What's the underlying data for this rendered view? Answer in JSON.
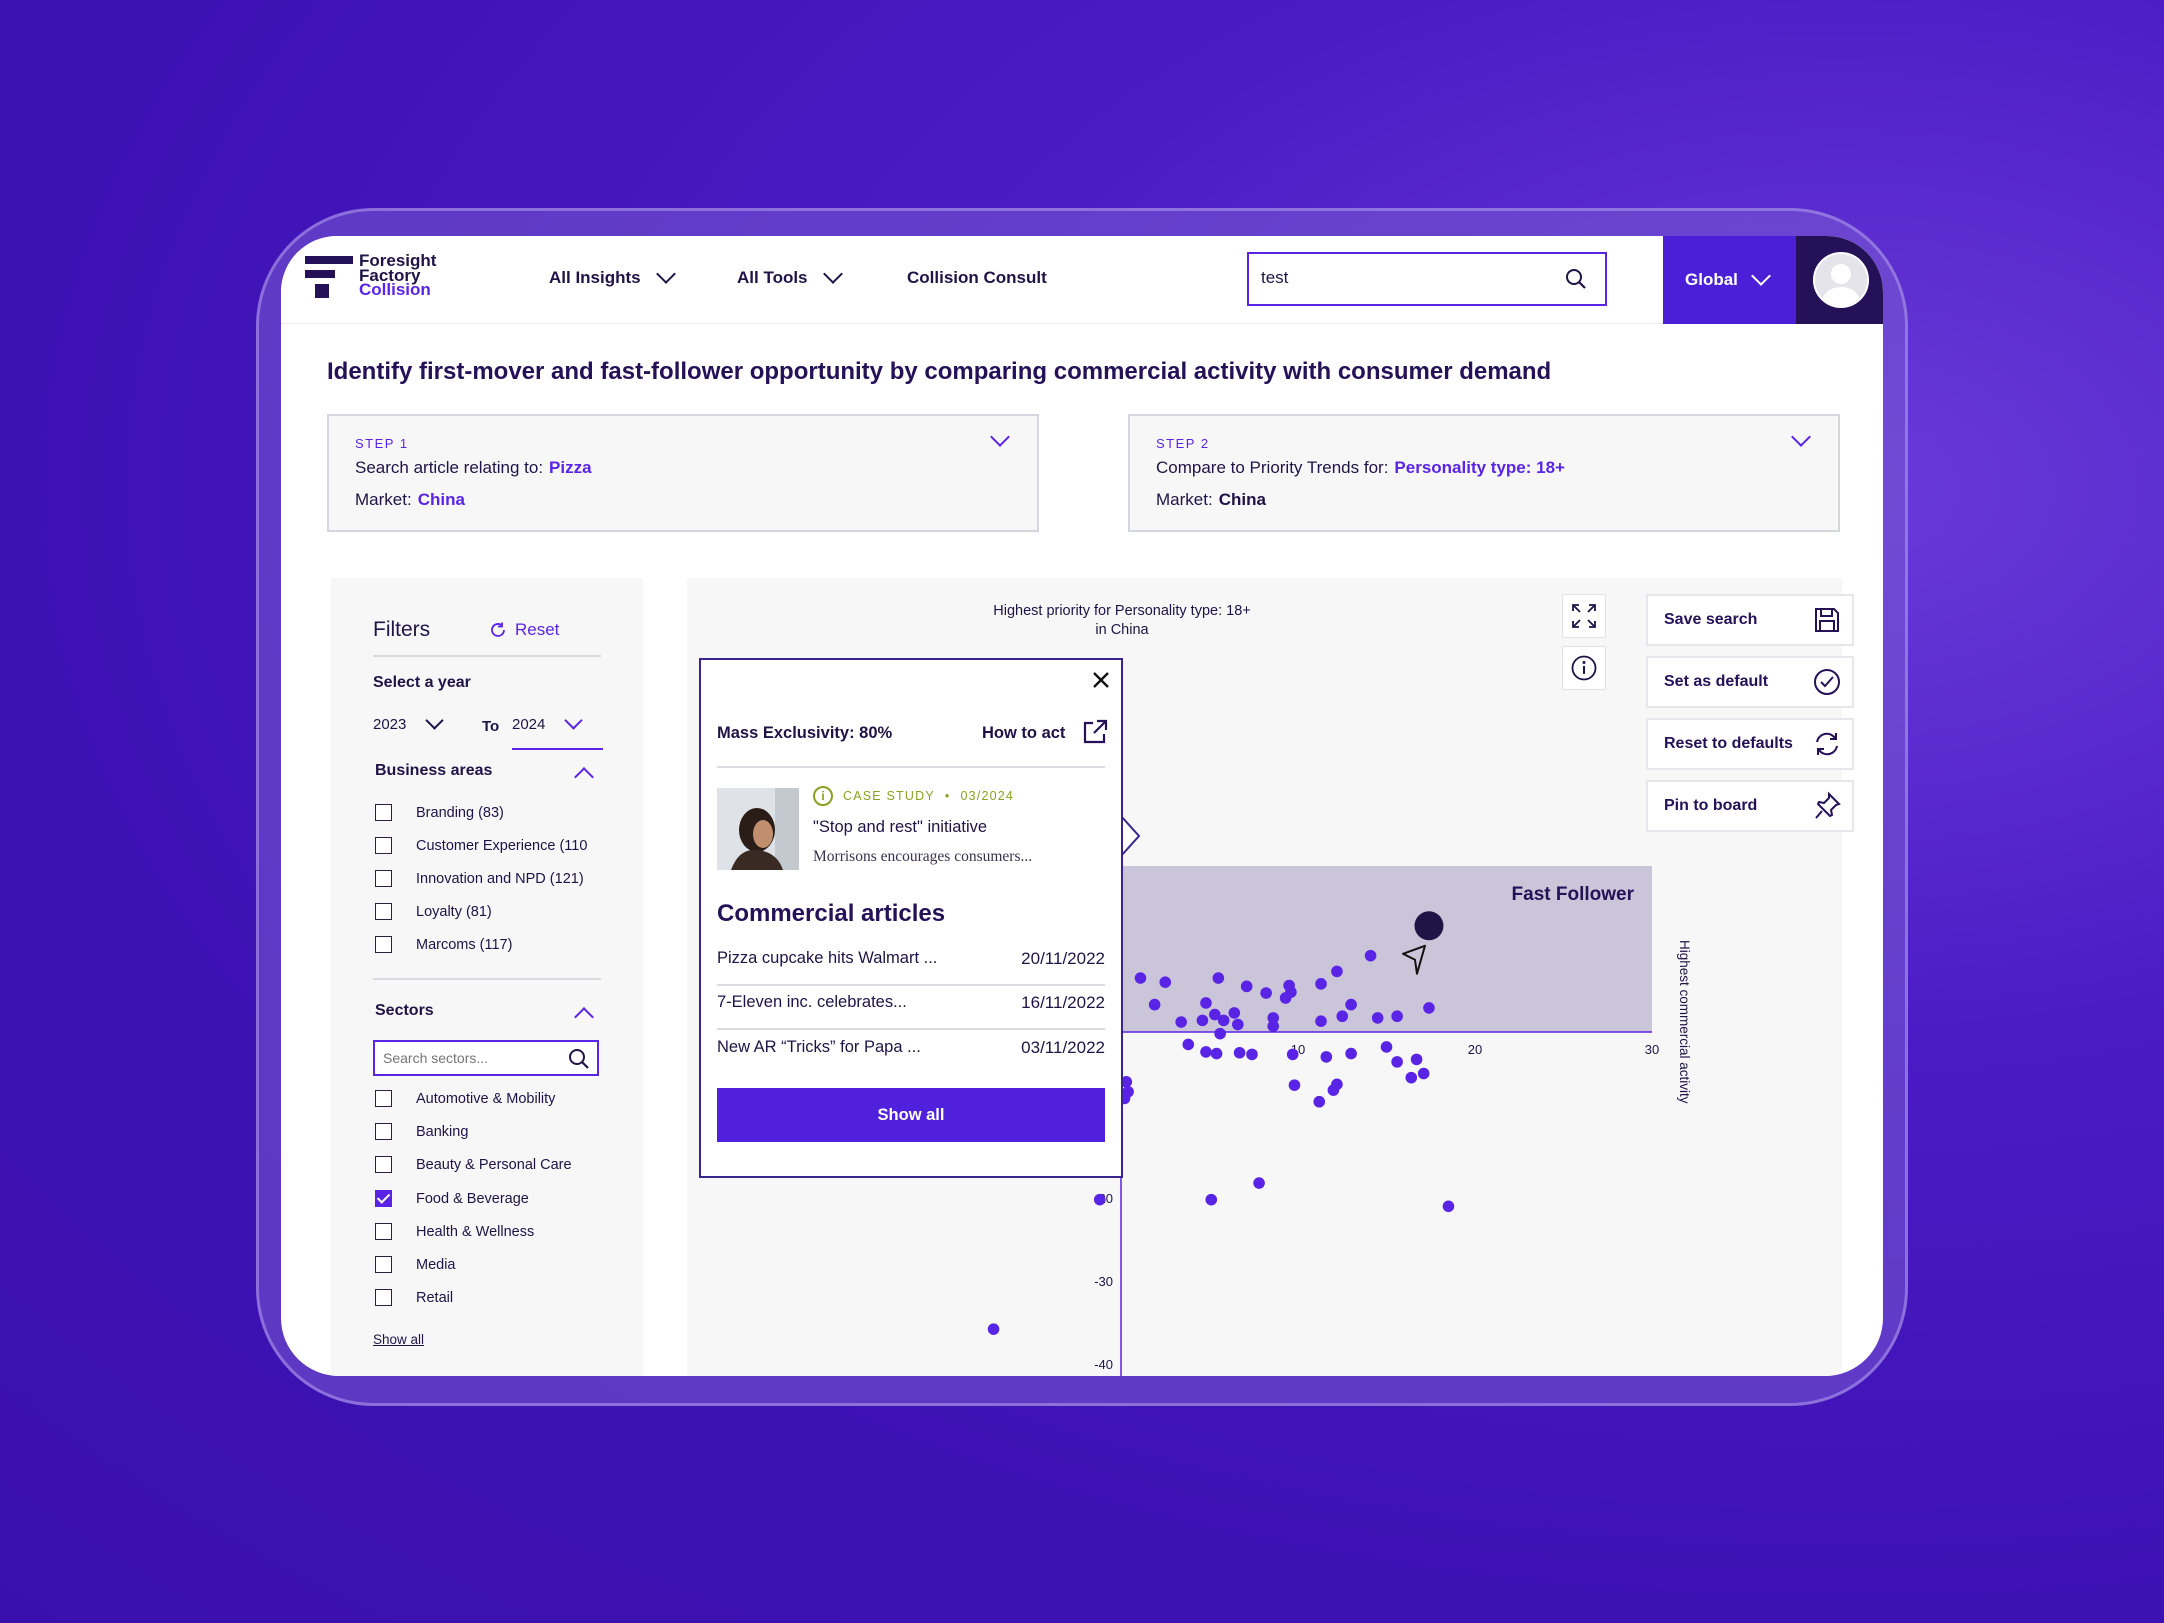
{
  "brand": {
    "line1": "Foresight",
    "line2": "Factory",
    "line3": "Collision"
  },
  "nav": {
    "insights": "All Insights",
    "tools": "All Tools",
    "consult": "Collision Consult"
  },
  "search": {
    "value": "test"
  },
  "region": {
    "label": "Global"
  },
  "headline": "Identify first-mover and fast-follower opportunity by comparing commercial activity with consumer demand",
  "step1": {
    "label": "STEP 1",
    "search_prefix": "Search article relating to:",
    "search_value": "Pizza",
    "market_prefix": "Market:",
    "market_value": "China"
  },
  "step2": {
    "label": "STEP 2",
    "compare_prefix": "Compare to Priority Trends for:",
    "compare_value": "Personality type: 18+",
    "market_prefix": "Market:",
    "market_value": "China"
  },
  "filters": {
    "title": "Filters",
    "reset": "Reset",
    "year_label": "Select a year",
    "year_from": "2023",
    "year_to_label": "To",
    "year_to": "2024",
    "business_title": "Business areas",
    "business": [
      {
        "label": "Branding (83)",
        "checked": false
      },
      {
        "label": "Customer Experience (110",
        "checked": false
      },
      {
        "label": "Innovation and NPD (121)",
        "checked": false
      },
      {
        "label": "Loyalty (81)",
        "checked": false
      },
      {
        "label": "Marcoms (117)",
        "checked": false
      }
    ],
    "sectors_title": "Sectors",
    "sector_placeholder": "Search sectors...",
    "sectors": [
      {
        "label": "Automotive & Mobility",
        "checked": false
      },
      {
        "label": "Banking",
        "checked": false
      },
      {
        "label": "Beauty & Personal Care",
        "checked": false
      },
      {
        "label": "Food & Beverage",
        "checked": true
      },
      {
        "label": "Health & Wellness",
        "checked": false
      },
      {
        "label": "Media",
        "checked": false
      },
      {
        "label": "Retail",
        "checked": false
      }
    ],
    "show_all": "Show all"
  },
  "actions": {
    "save": "Save search",
    "default": "Set as default",
    "reset": "Reset to defaults",
    "pin": "Pin to board"
  },
  "chart_data": {
    "type": "scatter",
    "title": "Highest priority for Personality type: 18+",
    "subtitle": "in China",
    "ylabel": "Highest commercial activity",
    "quadrant_label": "Fast Follower",
    "x_ticks": [
      "10",
      "20",
      "30"
    ],
    "y_ticks": [
      "-20",
      "-30",
      "-40"
    ],
    "xlim": [
      0,
      30
    ],
    "ylim": [
      -40,
      20
    ],
    "highlight": {
      "x": 17.4,
      "y": 12.8
    },
    "points": [
      [
        1.1,
        6.5
      ],
      [
        2.5,
        6.0
      ],
      [
        1.9,
        3.3
      ],
      [
        5.5,
        6.5
      ],
      [
        7.1,
        5.5
      ],
      [
        8.2,
        4.7
      ],
      [
        9.5,
        5.6
      ],
      [
        9.6,
        4.8
      ],
      [
        9.3,
        4.1
      ],
      [
        11.3,
        5.8
      ],
      [
        12.2,
        7.3
      ],
      [
        14.1,
        9.2
      ],
      [
        13.0,
        3.3
      ],
      [
        12.5,
        1.9
      ],
      [
        14.5,
        1.7
      ],
      [
        15.6,
        1.9
      ],
      [
        17.4,
        2.9
      ],
      [
        6.4,
        2.3
      ],
      [
        4.8,
        3.5
      ],
      [
        5.8,
        1.4
      ],
      [
        4.6,
        1.4
      ],
      [
        5.3,
        2.1
      ],
      [
        8.6,
        1.7
      ],
      [
        3.4,
        1.2
      ],
      [
        5.6,
        -0.2
      ],
      [
        8.6,
        0.7
      ],
      [
        11.3,
        1.3
      ],
      [
        6.6,
        0.9
      ],
      [
        6.7,
        -2.5
      ],
      [
        4.8,
        -2.4
      ],
      [
        3.8,
        -1.5
      ],
      [
        5.4,
        -2.6
      ],
      [
        7.4,
        -2.7
      ],
      [
        9.7,
        -2.7
      ],
      [
        11.6,
        -3.0
      ],
      [
        13.0,
        -2.6
      ],
      [
        15.0,
        -1.8
      ],
      [
        15.6,
        -3.6
      ],
      [
        16.7,
        -3.3
      ],
      [
        17.1,
        -5.0
      ],
      [
        9.8,
        -6.4
      ],
      [
        12.2,
        -6.3
      ],
      [
        12.0,
        -7.0
      ],
      [
        11.2,
        -8.4
      ],
      [
        16.4,
        -5.5
      ],
      [
        0.3,
        -6.0
      ],
      [
        0.2,
        -8.0
      ],
      [
        0.4,
        -7.2
      ],
      [
        -1.2,
        -20.2
      ],
      [
        5.1,
        -20.2
      ],
      [
        7.8,
        -18.2
      ],
      [
        18.5,
        -21.0
      ],
      [
        -7.2,
        -35.8
      ]
    ]
  },
  "popup": {
    "mass": "Mass Exclusivity: 80%",
    "how_to_act": "How to act",
    "case_label": "CASE STUDY",
    "case_date": "03/2024",
    "case_title": "\"Stop and rest\" initiative",
    "case_desc": "Morrisons encourages consumers...",
    "commercial_title": "Commercial articles",
    "articles": [
      {
        "title": "Pizza cupcake hits Walmart ...",
        "date": "20/11/2022"
      },
      {
        "title": "7-Eleven inc. celebrates...",
        "date": "16/11/2022"
      },
      {
        "title": "New AR “Tricks” for Papa ...",
        "date": "03/11/2022"
      }
    ],
    "show_all": "Show all"
  },
  "colors": {
    "accent": "#5a24e6",
    "dark": "#241158",
    "quadrant": "#cbc5d9",
    "background": "#3d12b3"
  }
}
